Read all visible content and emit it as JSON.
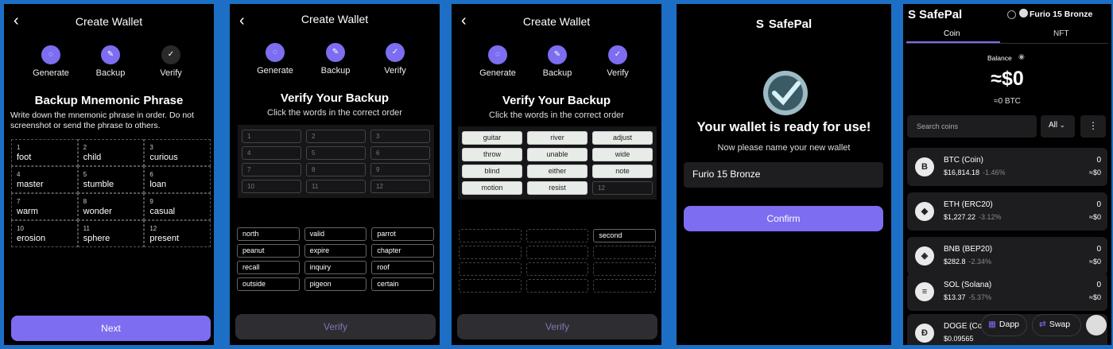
{
  "common": {
    "back_glyph": "‹",
    "create_wallet_title": "Create Wallet",
    "steps": {
      "generate": "Generate",
      "backup": "Backup",
      "verify": "Verify"
    },
    "verify_heading": "Verify Your Backup",
    "verify_sub": "Click the words in the correct order",
    "verify_button": "Verify"
  },
  "screen1": {
    "heading": "Backup Mnemonic Phrase",
    "instruction": "Write down the mnemonic phrase in order. Do not screenshot or send the phrase to others.",
    "words": [
      {
        "n": "1",
        "w": "foot"
      },
      {
        "n": "2",
        "w": "child"
      },
      {
        "n": "3",
        "w": "curious"
      },
      {
        "n": "4",
        "w": "master"
      },
      {
        "n": "5",
        "w": "stumble"
      },
      {
        "n": "6",
        "w": "loan"
      },
      {
        "n": "7",
        "w": "warm"
      },
      {
        "n": "8",
        "w": "wonder"
      },
      {
        "n": "9",
        "w": "casual"
      },
      {
        "n": "10",
        "w": "erosion"
      },
      {
        "n": "11",
        "w": "sphere"
      },
      {
        "n": "12",
        "w": "present"
      }
    ],
    "next_button": "Next"
  },
  "screen2": {
    "slots": [
      "1",
      "2",
      "3",
      "4",
      "5",
      "6",
      "7",
      "8",
      "9",
      "10",
      "11",
      "12"
    ],
    "choices": [
      "north",
      "valid",
      "parrot",
      "peanut",
      "expire",
      "chapter",
      "recall",
      "inquiry",
      "roof",
      "outside",
      "pigeon",
      "certain"
    ]
  },
  "screen3": {
    "selected": [
      "guitar",
      "river",
      "adjust",
      "throw",
      "unable",
      "wide",
      "blind",
      "either",
      "note",
      "motion",
      "resist"
    ],
    "next_slot": "12",
    "choices": [
      "",
      "",
      "second",
      "",
      "",
      "",
      "",
      "",
      "",
      "",
      "",
      ""
    ]
  },
  "screen4": {
    "brand": "SafePal",
    "heading": "Your wallet is ready for use!",
    "sub": "Now please name your new wallet",
    "wallet_name": "Furio 15 Bronze",
    "confirm_button": "Confirm"
  },
  "screen5": {
    "brand": "SafePal",
    "wallet_name": "Furio 15 Bronze",
    "tabs": {
      "coin": "Coin",
      "nft": "NFT"
    },
    "balance_label": "Balance",
    "balance_value": "≈$0",
    "balance_btc": "≈0 BTC",
    "search_placeholder": "Search coins",
    "filter": "All",
    "coins": [
      {
        "name": "BTC (Coin)",
        "price": "$16,814.18",
        "change": "-1.46%",
        "qty": "0",
        "value": "≈$0",
        "icon": "B"
      },
      {
        "name": "ETH (ERC20)",
        "price": "$1,227.22",
        "change": "-3.12%",
        "qty": "0",
        "value": "≈$0",
        "icon": "◆"
      },
      {
        "name": "BNB (BEP20)",
        "price": "$282.8",
        "change": "-2.34%",
        "qty": "0",
        "value": "≈$0",
        "icon": "◈"
      },
      {
        "name": "SOL (Solana)",
        "price": "$13.37",
        "change": "-5.37%",
        "qty": "0",
        "value": "≈$0",
        "icon": "≡"
      },
      {
        "name": "DOGE (Coi",
        "price": "$0.09565",
        "change": "",
        "qty": "",
        "value": "",
        "icon": "Ð"
      }
    ],
    "dapp_button": "Dapp",
    "swap_button": "Swap"
  },
  "colors": {
    "accent": "#7d6df0",
    "background": "#000000",
    "frame": "#1c6fc4"
  }
}
